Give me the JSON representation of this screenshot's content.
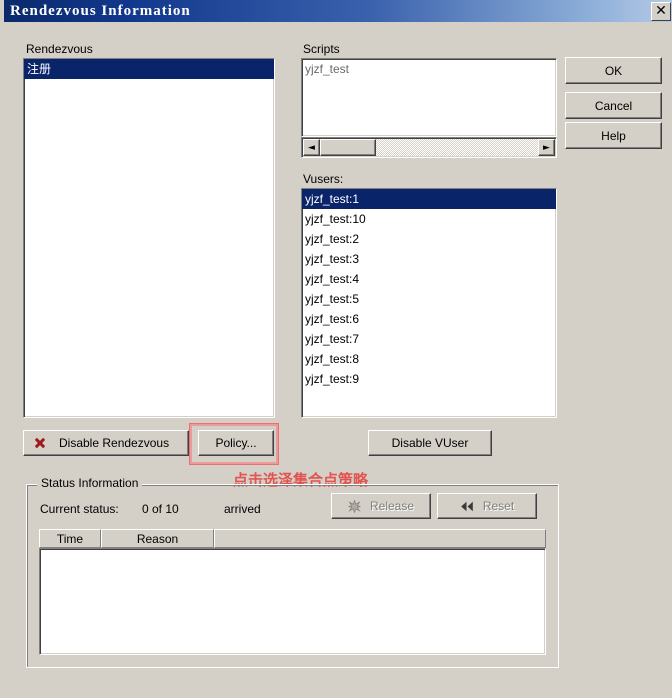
{
  "window": {
    "title": "Rendezvous Information",
    "close_label": "close-icon"
  },
  "rendezvous": {
    "label": "Rendezvous",
    "items": [
      {
        "name": "注册",
        "selected": true
      }
    ]
  },
  "scripts": {
    "label": "Scripts",
    "items": [
      {
        "name": "yjzf_test",
        "dim": true
      }
    ],
    "scrollbar": {
      "left_arrow": "◄",
      "right_arrow": "►"
    }
  },
  "vusers": {
    "label": "Vusers:",
    "items": [
      {
        "name": "yjzf_test:1",
        "selected": true
      },
      {
        "name": "yjzf_test:10",
        "selected": false
      },
      {
        "name": "yjzf_test:2",
        "selected": false
      },
      {
        "name": "yjzf_test:3",
        "selected": false
      },
      {
        "name": "yjzf_test:4",
        "selected": false
      },
      {
        "name": "yjzf_test:5",
        "selected": false
      },
      {
        "name": "yjzf_test:6",
        "selected": false
      },
      {
        "name": "yjzf_test:7",
        "selected": false
      },
      {
        "name": "yjzf_test:8",
        "selected": false
      },
      {
        "name": "yjzf_test:9",
        "selected": false
      }
    ]
  },
  "dialog_buttons": {
    "ok": "OK",
    "cancel": "Cancel",
    "help": "Help"
  },
  "actions": {
    "disable_rendezvous": "Disable Rendezvous",
    "disable_rendezvous_icon": "red-x-icon",
    "policy": "Policy...",
    "disable_vuser": "Disable VUser"
  },
  "status_information": {
    "label": "Status Information",
    "current_status_label": "Current status:",
    "current_status_value": "0 of 10",
    "arrived_label": "arrived",
    "release_button": "Release",
    "release_icon": "burst-icon",
    "reset_button": "Reset",
    "reset_icon": "rewind-icon",
    "table": {
      "columns": [
        "Time",
        "Reason",
        ""
      ],
      "rows": []
    }
  },
  "annotation": {
    "text": "点击选泽集合点策略",
    "highlight_target": "policy-button",
    "color": "#e53935"
  }
}
